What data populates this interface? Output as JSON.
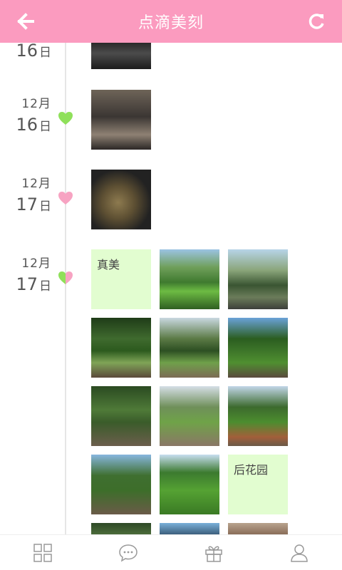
{
  "header": {
    "title": "点滴美刻"
  },
  "icons": {
    "back": "back-arrow-icon",
    "refresh": "refresh-icon",
    "heart": "heart-icon",
    "grid": "grid-icon",
    "chat": "chat-bubble-icon",
    "gift": "gift-icon",
    "user": "user-icon"
  },
  "colors": {
    "header_bg": "#fb9bbf",
    "note_bg": "#e2fdd0",
    "heart_green": "#8fe05a",
    "heart_pink": "#f7a3c2"
  },
  "timeline": [
    {
      "day": "16",
      "day_unit": "日",
      "month": null,
      "heart": null
    },
    {
      "month": "12月",
      "day": "16",
      "day_unit": "日",
      "heart": "green"
    },
    {
      "month": "12月",
      "day": "17",
      "day_unit": "日",
      "heart": "pink"
    },
    {
      "month": "12月",
      "day": "17",
      "day_unit": "日",
      "heart": "mixed",
      "notes": [
        "真美",
        "后花园"
      ]
    }
  ]
}
